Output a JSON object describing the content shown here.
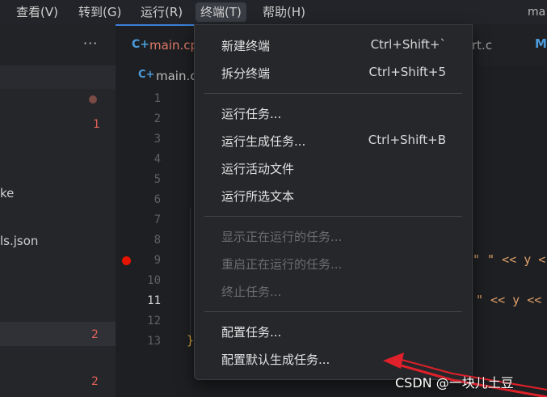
{
  "menubar": {
    "items": [
      "查看(V)",
      "转到(G)",
      "运行(R)",
      "终端(T)",
      "帮助(H)"
    ],
    "active_index": 3,
    "title_fragment": "ma"
  },
  "sidebar": {
    "more_label": "···",
    "rows": [
      {
        "text": "",
        "badge": "1"
      },
      {
        "text": "ke",
        "badge": ""
      },
      {
        "text": "ls.json",
        "badge": ""
      },
      {
        "text": "",
        "badge": "2"
      },
      {
        "text": "",
        "badge": "2"
      }
    ]
  },
  "tabs": {
    "active_label": "main.cp",
    "active_icon": "C+",
    "other_label": "rt.c",
    "third_icon": "M"
  },
  "breadcrumb": {
    "icon": "C+",
    "label": "main.c"
  },
  "editor": {
    "line_numbers": [
      "1",
      "2",
      "3",
      "4",
      "5",
      "6",
      "7",
      "8",
      "9",
      "10",
      "11",
      "12",
      "13"
    ],
    "current_line": "11",
    "breakpoint_line": "9",
    "frag_line9": "\" \" << y <",
    "frag_line11": "\" << y <<",
    "frag_line13": "}"
  },
  "terminal_menu": {
    "groups": [
      [
        {
          "label": "新建终端",
          "shortcut": "Ctrl+Shift+`",
          "enabled": true
        },
        {
          "label": "拆分终端",
          "shortcut": "Ctrl+Shift+5",
          "enabled": true
        }
      ],
      [
        {
          "label": "运行任务...",
          "shortcut": "",
          "enabled": true
        },
        {
          "label": "运行生成任务...",
          "shortcut": "Ctrl+Shift+B",
          "enabled": true
        },
        {
          "label": "运行活动文件",
          "shortcut": "",
          "enabled": true
        },
        {
          "label": "运行所选文本",
          "shortcut": "",
          "enabled": true
        }
      ],
      [
        {
          "label": "显示正在运行的任务...",
          "shortcut": "",
          "enabled": false
        },
        {
          "label": "重启正在运行的任务...",
          "shortcut": "",
          "enabled": false
        },
        {
          "label": "终止任务...",
          "shortcut": "",
          "enabled": false
        }
      ],
      [
        {
          "label": "配置任务...",
          "shortcut": "",
          "enabled": true
        },
        {
          "label": "配置默认生成任务...",
          "shortcut": "",
          "enabled": true
        }
      ]
    ]
  },
  "watermark": "CSDN @一块儿土豆",
  "colors": {
    "accent": "#3b7fd6",
    "error_badge": "#e0615a",
    "breakpoint": "#e51400",
    "annotation_arrow": "#e0202a"
  }
}
